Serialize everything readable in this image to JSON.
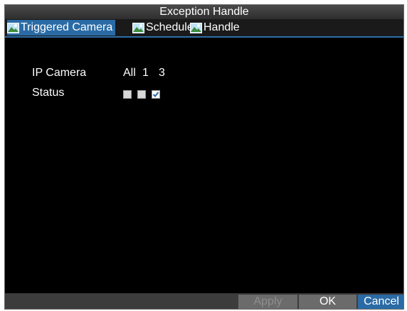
{
  "window": {
    "title": "Exception Handle"
  },
  "tabs": [
    {
      "label": "Triggered Camera",
      "icon": "picture-icon"
    },
    {
      "label": "Schedule",
      "icon": "picture-icon"
    },
    {
      "label": "Handle",
      "icon": "picture-icon"
    }
  ],
  "form": {
    "ip_camera_label": "IP Camera",
    "status_label": "Status",
    "camera_headers": [
      "All",
      "1",
      "3"
    ],
    "status_checks": [
      false,
      false,
      true
    ]
  },
  "buttons": {
    "apply": "Apply",
    "ok": "OK",
    "cancel": "Cancel"
  },
  "colors": {
    "accent": "#2a6ba6",
    "background": "#000000",
    "footer": "#3c3c3c"
  }
}
